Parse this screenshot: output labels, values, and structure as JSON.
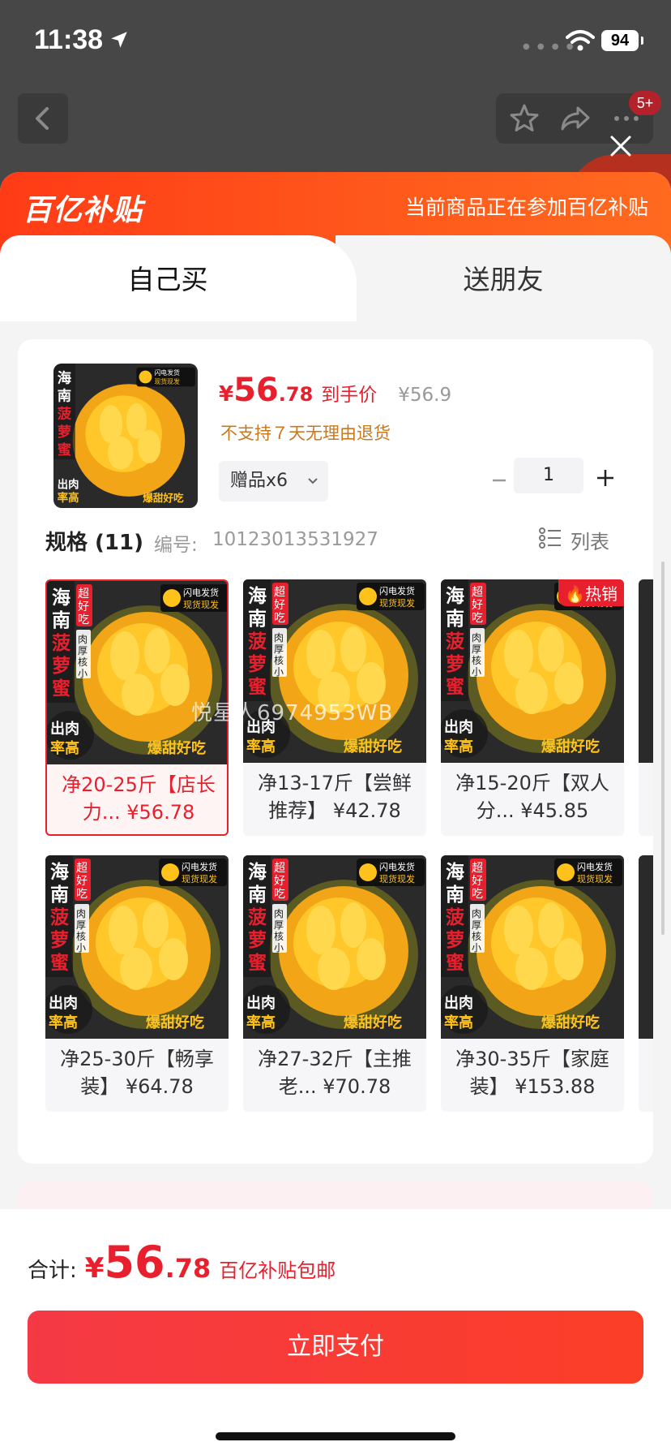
{
  "status_bar": {
    "time": "11:38",
    "battery": "94"
  },
  "nav": {
    "badge": "5+"
  },
  "banner": {
    "logo": "百亿补贴",
    "notice": "当前商品正在参加百亿补贴"
  },
  "tabs": [
    {
      "label": "自己买",
      "active": true
    },
    {
      "label": "送朋友",
      "active": false
    }
  ],
  "product": {
    "price_currency": "¥",
    "price_integer": "56",
    "price_decimal": ".78",
    "price_tag": "到手价",
    "original_price": "¥56.9",
    "return_policy": "不支持７天无理由退货",
    "gift_label": "赠品x6",
    "quantity": "1",
    "image_text": {
      "side": "海南菠萝蜜",
      "hot": "超好吃",
      "ship": "闪电发货 现货现发",
      "thick": "肉厚核小",
      "meat": "出肉率高",
      "sweet": "爆甜好吃"
    }
  },
  "spec": {
    "title": "规格 (11)",
    "number_label": "编号:",
    "number": "10123013531927",
    "list_view": "列表"
  },
  "spec_items": [
    {
      "label": "净20-25斤【店长力... ¥56.78",
      "selected": true,
      "hot": ""
    },
    {
      "label": "净13-17斤【尝鲜推荐】 ¥42.78",
      "selected": false,
      "hot": ""
    },
    {
      "label": "净15-20斤【双人分... ¥45.85",
      "selected": false,
      "hot": "热销"
    },
    {
      "label": "净25-30斤【畅享装】 ¥64.78",
      "selected": false,
      "hot": ""
    },
    {
      "label": "净27-32斤【主推老... ¥70.78",
      "selected": false,
      "hot": ""
    },
    {
      "label": "净30-35斤【家庭装】 ¥153.88",
      "selected": false,
      "hot": ""
    }
  ],
  "watermark": "悦星人6974953WB",
  "footer": {
    "total_label": "合计:",
    "total_currency": "¥",
    "total_integer": "56",
    "total_decimal": ".78",
    "total_note": "百亿补贴包邮",
    "pay_button": "立即支付"
  },
  "colors": {
    "accent": "#e8202e",
    "banner": "#ff4a1a",
    "gold": "#ffc21a"
  }
}
